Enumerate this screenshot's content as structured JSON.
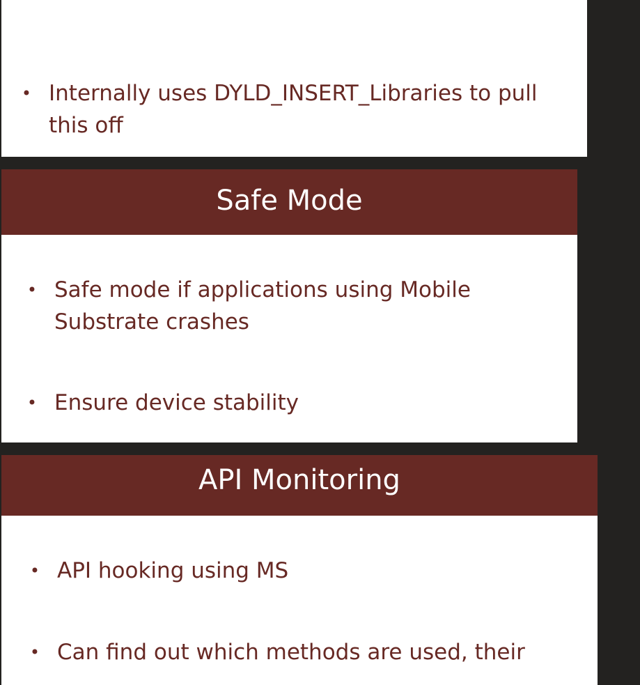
{
  "colors": {
    "header_bg": "#672924",
    "header_text": "#ffffff",
    "body_text": "#672924",
    "slide_bg": "#ffffff",
    "page_bg": "#232220"
  },
  "slides": [
    {
      "title": "",
      "bullets": [
        {
          "symbol": "•",
          "text": "Internally uses DYLD_INSERT_Libraries to pull this off"
        }
      ]
    },
    {
      "title": "Safe Mode",
      "bullets": [
        {
          "symbol": "•",
          "text": "Safe mode if applications using Mobile Substrate crashes"
        },
        {
          "symbol": "•",
          "text": "Ensure device stability"
        }
      ]
    },
    {
      "title": "API Monitoring",
      "bullets": [
        {
          "symbol": "•",
          "text": "API hooking using MS"
        },
        {
          "symbol": "•",
          "text": "Can find out which methods are used, their"
        }
      ]
    }
  ]
}
